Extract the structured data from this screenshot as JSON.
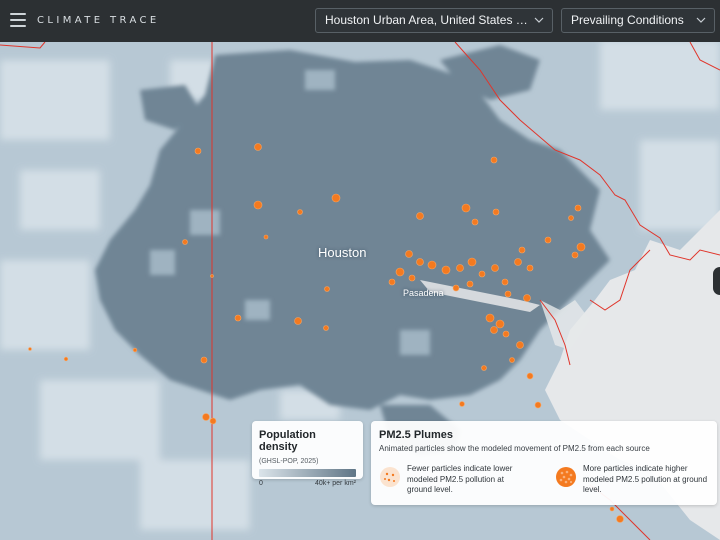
{
  "header": {
    "brand": "CLIMATE TRACE",
    "area_select": {
      "value": "Houston Urban Area, United States of A..."
    },
    "condition_select": {
      "value": "Prevailing Conditions"
    }
  },
  "map": {
    "city_label": "Houston",
    "sub_label": "Pasadena"
  },
  "legend": {
    "population": {
      "title": "Population density",
      "subtitle": "(GHSL-POP, 2025)",
      "min_label": "0",
      "max_label": "40k+ per km²",
      "gradient_from": "#dbe4ea",
      "gradient_to": "#5f7586"
    },
    "plumes": {
      "title": "PM2.5 Plumes",
      "subtitle": "Animated particles show the modeled movement of PM2.5 from each source",
      "fewer_text": "Fewer particles indicate lower modeled PM2.5 pollution at ground level.",
      "more_text": "More particles indicate higher modeled PM2.5 pollution at ground level.",
      "plume_color": "#f47a20"
    }
  },
  "colors": {
    "topbar": "#2c3033",
    "boundary": "#e0352b",
    "urban": "#6f8595",
    "water": "#e6e8ea"
  }
}
